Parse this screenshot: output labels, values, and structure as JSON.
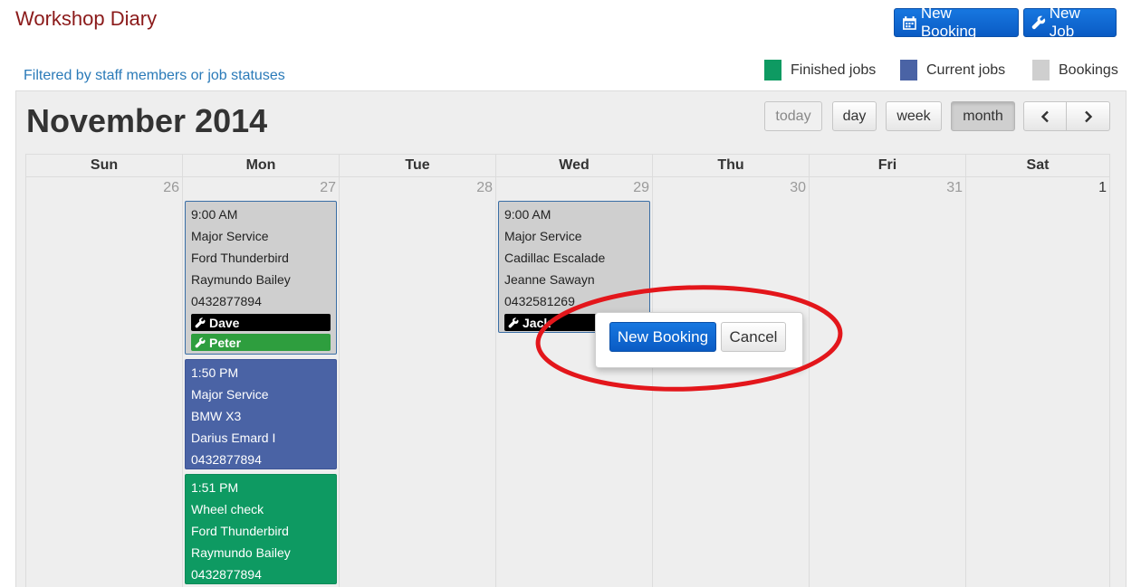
{
  "header": {
    "title": "Workshop Diary",
    "new_booking_label": "New Booking",
    "new_job_label": "New Job",
    "filter_link": "Filtered by staff members or job statuses"
  },
  "legend": [
    {
      "label": "Finished jobs",
      "color": "#0e9a62"
    },
    {
      "label": "Current jobs",
      "color": "#4a63a5"
    },
    {
      "label": "Bookings",
      "color": "#cfcfcf"
    }
  ],
  "calendar": {
    "title": "November 2014",
    "view_buttons": {
      "today": "today",
      "day": "day",
      "week": "week",
      "month": "month"
    },
    "active_view": "month",
    "nav_prev_icon": "chevron-left-icon",
    "nav_next_icon": "chevron-right-icon",
    "weekdays": [
      "Sun",
      "Mon",
      "Tue",
      "Wed",
      "Thu",
      "Fri",
      "Sat"
    ],
    "day_numbers": [
      "26",
      "27",
      "28",
      "29",
      "30",
      "31",
      "1"
    ],
    "events": {
      "mon_booking": {
        "time": "9:00 AM",
        "service": "Major Service",
        "vehicle": "Ford Thunderbird",
        "customer": "Raymundo Bailey",
        "phone": "0432877894",
        "staff": [
          "Dave",
          "Peter"
        ]
      },
      "mon_current": {
        "time": "1:50 PM",
        "service": "Major Service",
        "vehicle": "BMW X3",
        "customer": "Darius Emard I",
        "phone": "0432877894"
      },
      "mon_finished": {
        "time": "1:51 PM",
        "service": "Wheel check",
        "vehicle": "Ford Thunderbird",
        "customer": "Raymundo Bailey",
        "phone": "0432877894"
      },
      "wed_booking": {
        "time": "9:00 AM",
        "service": "Major Service",
        "vehicle": "Cadillac Escalade",
        "customer": "Jeanne Sawayn",
        "phone": "0432581269",
        "staff": [
          "Jack"
        ]
      }
    }
  },
  "popover": {
    "new_booking_label": "New Booking",
    "cancel_label": "Cancel"
  },
  "colors": {
    "title": "#8b1a1a",
    "link": "#2a7ab8",
    "primary": "#1777e0",
    "annotation": "#e3161b"
  }
}
